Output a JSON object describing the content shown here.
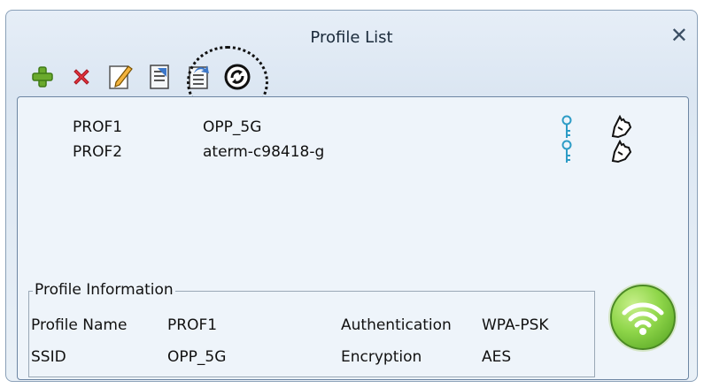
{
  "window": {
    "title": "Profile List",
    "close_symbol": "✕"
  },
  "toolbar": [
    {
      "name": "add-profile-button",
      "icon": "plus-icon"
    },
    {
      "name": "delete-profile-button",
      "icon": "x-delete-icon"
    },
    {
      "name": "edit-profile-button",
      "icon": "pencil-edit-icon"
    },
    {
      "name": "import-profile-button",
      "icon": "document-import-icon"
    },
    {
      "name": "export-profile-button",
      "icon": "document-export-icon"
    },
    {
      "name": "connect-profile-button",
      "icon": "refresh-connect-icon"
    }
  ],
  "profiles": [
    {
      "name": "PROF1",
      "ssid": "OPP_5G"
    },
    {
      "name": "PROF2",
      "ssid": "aterm-c98418-g"
    }
  ],
  "profile_info": {
    "legend": "Profile Information",
    "profile_name_label": "Profile Name",
    "profile_name_value": "PROF1",
    "ssid_label": "SSID",
    "ssid_value": "OPP_5G",
    "auth_label": "Authentication",
    "auth_value": "WPA-PSK",
    "enc_label": "Encryption",
    "enc_value": "AES"
  },
  "colors": {
    "accent": "#6aaa2d",
    "delete": "#e0323c",
    "key": "#2d9cc6"
  }
}
